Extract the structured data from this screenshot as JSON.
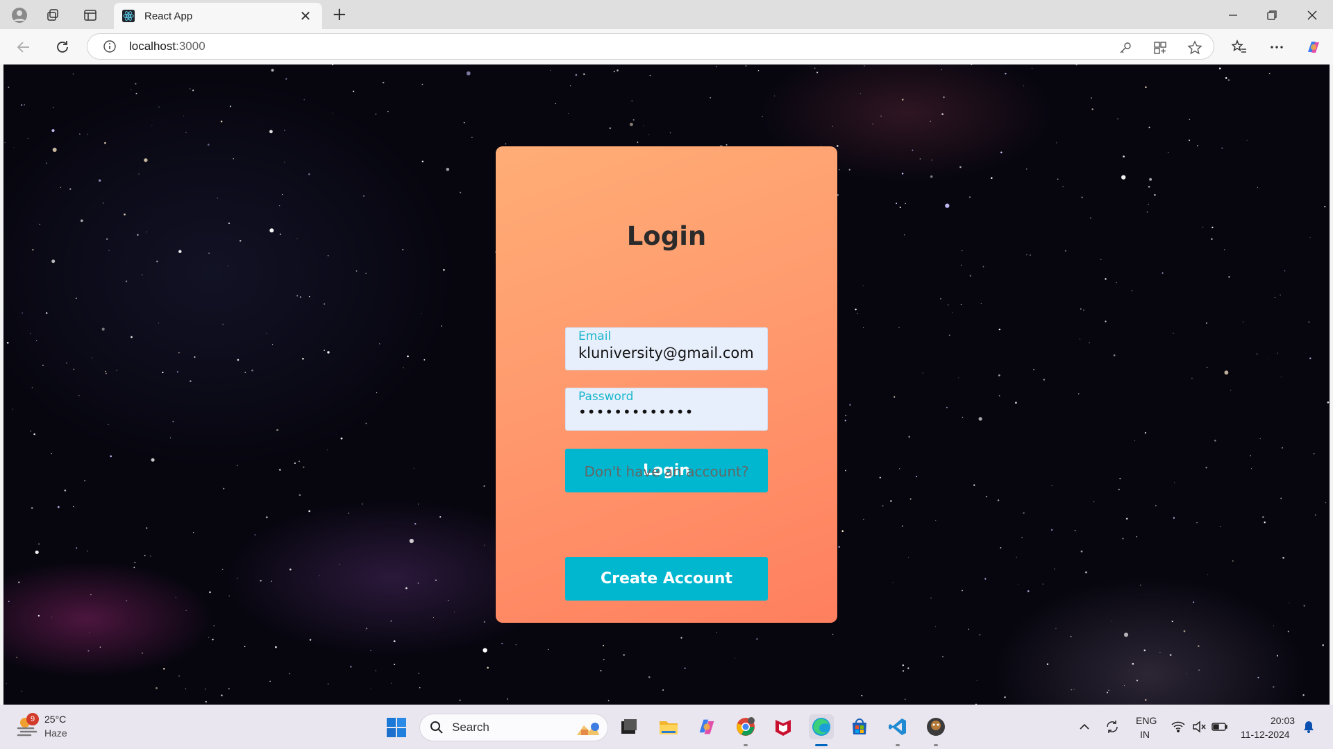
{
  "browser": {
    "tab_title": "React App",
    "tab_close": "✕",
    "new_tab": "+",
    "url_host": "localhost",
    "url_port": ":3000"
  },
  "login": {
    "title": "Login",
    "email_label": "Email",
    "email_value": "kluniversity@gmail.com",
    "password_label": "Password",
    "password_value": "•••••••••••••",
    "login_button": "Login",
    "no_account_prompt": "Don't have an account?",
    "create_account_button": "Create Account"
  },
  "taskbar": {
    "weather_temp": "25°C",
    "weather_condition": "Haze",
    "weather_badge": "9",
    "search_label": "Search",
    "language": "ENG",
    "region": "IN",
    "time": "20:03",
    "date": "11-12-2024",
    "apps": [
      "task-view",
      "file-explorer",
      "copilot",
      "chrome",
      "mcafee",
      "edge",
      "microsoft-store",
      "vscode",
      "app-avatar"
    ]
  },
  "colors": {
    "card_top": "#ffad76",
    "card_bottom": "#ff7f5e",
    "accent": "#00b7cf",
    "label": "#19b6cc",
    "title": "#2b2b2b"
  }
}
